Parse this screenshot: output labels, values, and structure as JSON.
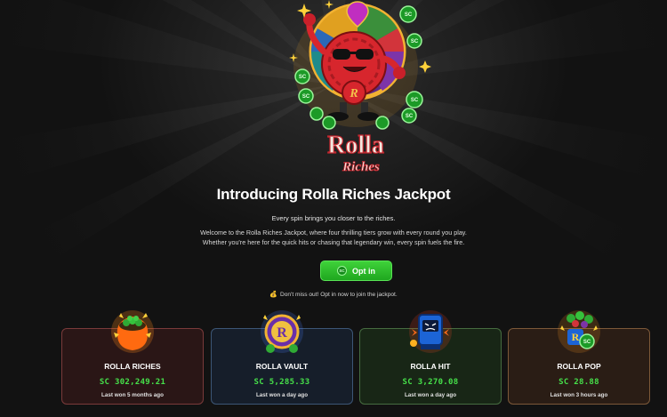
{
  "hero": {
    "logo_line1": "Rolla",
    "logo_line2": "Riches",
    "mascot_letter": "R",
    "coin_label": "SC"
  },
  "intro": {
    "title": "Introducing Rolla Riches Jackpot",
    "subtitle": "Every spin brings you closer to the riches.",
    "description": "Welcome to the Rolla Riches Jackpot, where four thrilling tiers grow with every round you play. Whether you're here for the quick hits or chasing that legendary win, every spin fuels the fire."
  },
  "optin": {
    "badge": "SC",
    "label": "Opt in"
  },
  "notice": {
    "icon": "money-bag-icon",
    "text": "Don't miss out! Opt in now to join the jackpot."
  },
  "tiers": [
    {
      "name": "ROLLA RICHES",
      "amount": "SC 302,249.21",
      "last_won": "Last won 5 months ago",
      "icon": "treasure-pot-icon",
      "accent": "#7a3a3a"
    },
    {
      "name": "ROLLA VAULT",
      "amount": "SC 5,285.33",
      "last_won": "Last won a day ago",
      "icon": "vault-coin-icon",
      "accent": "#3c5676"
    },
    {
      "name": "ROLLA HIT",
      "amount": "SC 3,270.08",
      "last_won": "Last won a day ago",
      "icon": "slot-machine-icon",
      "accent": "#466c40"
    },
    {
      "name": "ROLLA POP",
      "amount": "SC 28.88",
      "last_won": "Last won 3 hours ago",
      "icon": "coin-burst-icon",
      "accent": "#7c5838"
    }
  ],
  "colors": {
    "background": "#121212",
    "accent_green": "#2fbd2c",
    "amount_green": "#46e04a",
    "logo_red": "#d8323a"
  }
}
